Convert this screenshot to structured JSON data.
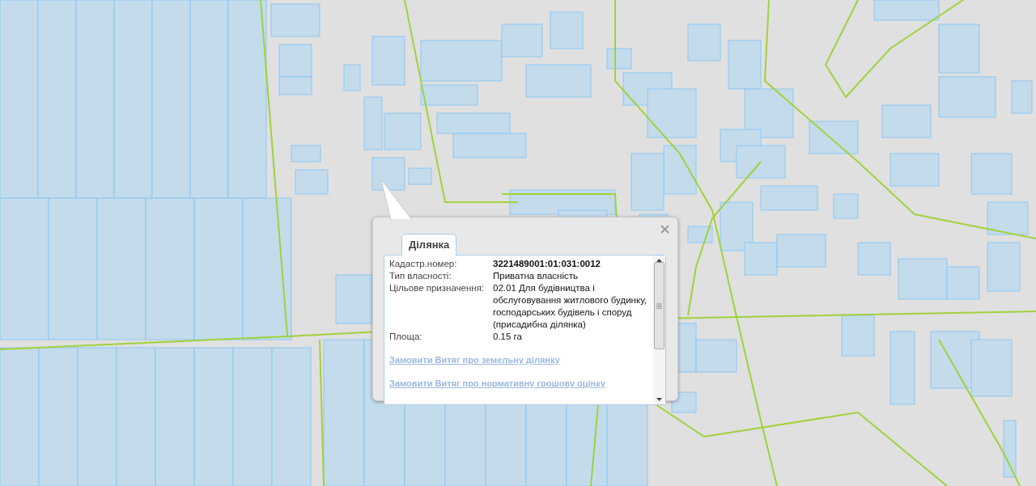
{
  "popup": {
    "tabs": [
      {
        "label": "Ділянка",
        "selected": true
      }
    ],
    "fields": [
      {
        "label": "Кадастр.номер:",
        "value": "3221489001:01:031:0012",
        "kind": "bold"
      },
      {
        "label": "Тип власності:",
        "value": "Приватна власність",
        "kind": "plain"
      },
      {
        "label": "Цільове призначення:",
        "value": "02.01 Для будівництва і обслуговування житлового будинку, господарських будівель і споруд (присадибна ділянка)",
        "kind": "plain"
      },
      {
        "label": "Площа:",
        "value": "0.15 га",
        "kind": "plain"
      }
    ],
    "links": [
      "Замовити Витяг про земельну ділянку",
      "Замовити Витяг про нормативну грошову оцінку"
    ]
  }
}
